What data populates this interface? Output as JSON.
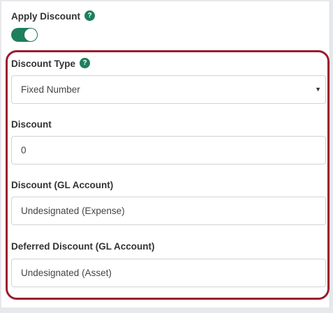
{
  "apply_discount": {
    "label": "Apply Discount",
    "help_icon": "question-icon",
    "toggle_on": true
  },
  "discount_type": {
    "label": "Discount Type",
    "help_icon": "question-icon",
    "selected": "Fixed Number",
    "arrow_icon": "caret-down-icon"
  },
  "discount": {
    "label": "Discount",
    "value": "0"
  },
  "discount_gl_account": {
    "label": "Discount (GL Account)",
    "value": "Undesignated (Expense)"
  },
  "deferred_discount_gl_account": {
    "label": "Deferred Discount (GL Account)",
    "value": "Undesignated (Asset)"
  },
  "colors": {
    "accent_green": "#1e7f5c",
    "highlight_red": "#9b1c2e"
  }
}
